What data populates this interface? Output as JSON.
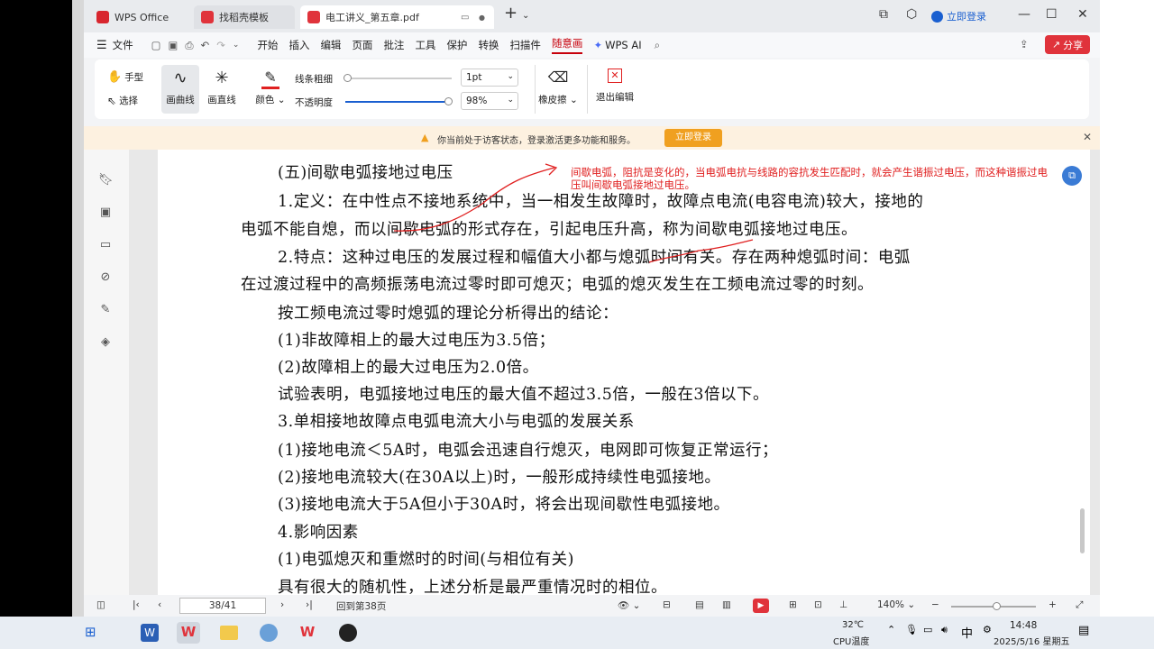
{
  "tabs": [
    {
      "label": "WPS Office",
      "color": "#d8262e"
    },
    {
      "label": "找稻壳模板",
      "color": "#e0333b"
    },
    {
      "label": "电工讲义_第五章.pdf",
      "color": "#e0333b"
    }
  ],
  "window": {
    "login": "立即登录"
  },
  "menu": {
    "file": "文件",
    "items": [
      "开始",
      "插入",
      "编辑",
      "页面",
      "批注",
      "工具",
      "保护",
      "转换",
      "扫描件",
      "随意画"
    ],
    "ai": "WPS AI",
    "share": "分享"
  },
  "ribbon": {
    "hand": "手型",
    "select": "选择",
    "curve": "画曲线",
    "straight": "画直线",
    "color": "颜色",
    "line_width_label": "线条粗细",
    "line_width_value": "1pt",
    "opacity_label": "不透明度",
    "opacity_value": "98%",
    "eraser": "橡皮擦",
    "exit": "退出编辑"
  },
  "notice": {
    "text": "你当前处于访客状态，登录激活更多功能和服务。",
    "button": "立即登录"
  },
  "doc": {
    "heading": "(五)间歇电弧接地过电压",
    "lines": [
      "1.定义：在中性点不接地系统中，当一相发生故障时，故障点电流(电容电流)较大，接地的",
      "电弧不能自熄，而以间歇电弧的形式存在，引起电压升高，称为间歇电弧接地过电压。",
      "2.特点：这种过电压的发展过程和幅值大小都与熄弧时间有关。存在两种熄弧时间：电弧",
      "在过渡过程中的高频振荡电流过零时即可熄灭；电弧的熄灭发生在工频电流过零的时刻。",
      "按工频电流过零时熄弧的理论分析得出的结论：",
      "(1)非故障相上的最大过电压为3.5倍；",
      "(2)故障相上的最大过电压为2.0倍。",
      "试验表明，电弧接地过电压的最大值不超过3.5倍，一般在3倍以下。",
      "3.单相接地故障点电弧电流大小与电弧的发展关系",
      "(1)接地电流＜5A时，电弧会迅速自行熄灭，电网即可恢复正常运行；",
      "(2)接地电流较大(在30A以上)时，一般形成持续性电弧接地。",
      "(3)接地电流大于5A但小于30A时，将会出现间歇性电弧接地。",
      "4.影响因素",
      "(1)电弧熄灭和重燃时的时间(与相位有关)",
      "具有很大的随机性，上述分析是最严重情况时的相位。"
    ],
    "annotation": "间歇电弧，阻抗是变化的，当电弧电抗与线路的容抗发生匹配时，就会产生谐振过电压，而这种谐振过电压叫间歇电弧接地过电压。"
  },
  "status": {
    "page_input": "38/41",
    "goto": "回到第38页",
    "zoom": "140%"
  },
  "taskbar": {
    "temp": "32℃",
    "cpu": "CPU温度",
    "ime": "中",
    "time": "14:48",
    "date": "2025/5/16 星期五"
  },
  "colors": {
    "accent": "#c7000b",
    "annot": "#e02020",
    "notice_btn": "#f0a020"
  }
}
